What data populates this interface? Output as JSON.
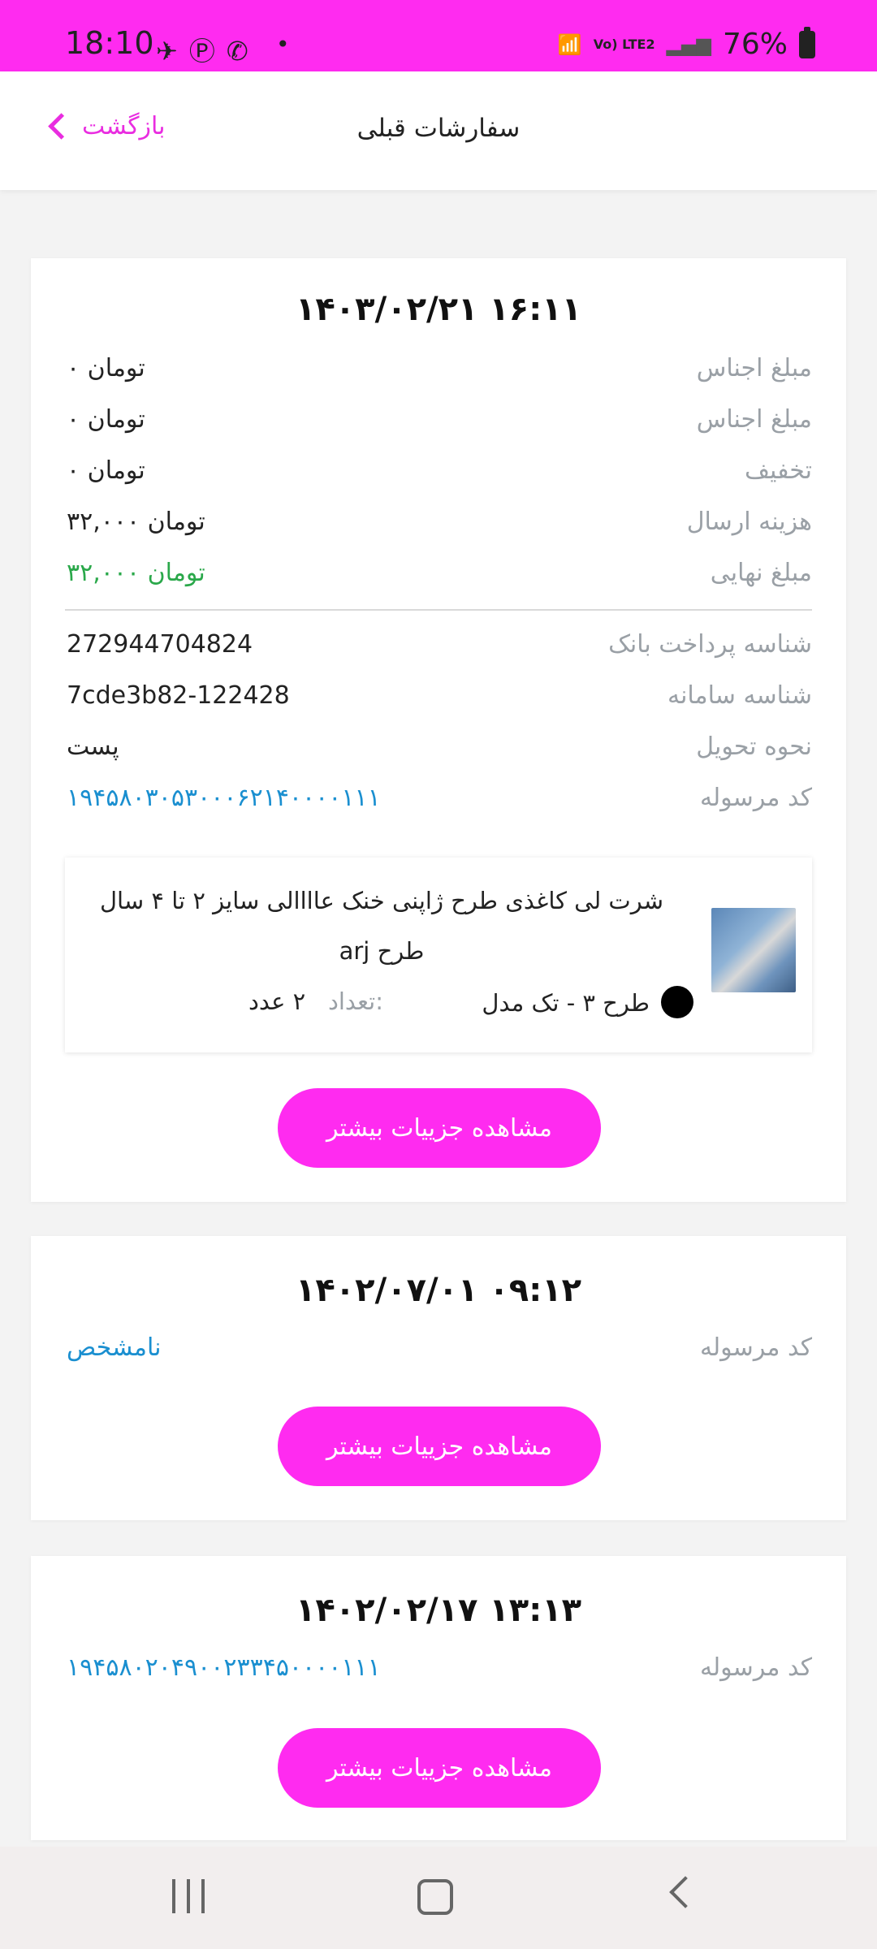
{
  "status_bar": {
    "time": "18:10",
    "battery": "76%",
    "network": "Vo) LTE2",
    "left_icons": [
      "navigation-icon",
      "pinterest-icon",
      "whatsapp-icon"
    ],
    "colors": {
      "bar": "#ff2bf0"
    }
  },
  "header": {
    "title": "سفارشات قبلی",
    "back_label": "بازگشت"
  },
  "orders": [
    {
      "date": "۱۴۰۳/۰۲/۲۱ ۱۶:۱۱",
      "rows": [
        {
          "label": "مبلغ اجناس",
          "value": "۰ تومان"
        },
        {
          "label": "مبلغ اجناس",
          "value": "۰ تومان"
        },
        {
          "label": "تخفیف",
          "value": "۰ تومان"
        },
        {
          "label": "هزینه ارسال",
          "value": "۳۲,۰۰۰ تومان"
        },
        {
          "label": "مبلغ نهایی",
          "value": "۳۲,۰۰۰ تومان"
        }
      ],
      "rows2": [
        {
          "label": "شناسه پرداخت بانک",
          "value": "272944704824"
        },
        {
          "label": "شناسه سامانه",
          "value": "7cde3b82-122428"
        },
        {
          "label": "نحوه تحویل",
          "value": "پست"
        },
        {
          "label": "کد مرسوله",
          "value": "۱۹۴۵۸۰۳۰۵۳۰۰۰۶۲۱۴۰۰۰۰۱۱۱"
        }
      ],
      "item": {
        "title": "شرت لی کاغذی طرح ژاپنی خنک عاااالی سایز ۲ تا ۴ سال طرح arj",
        "variant": "طرح ۳  - تک مدل",
        "qty_label": "تعداد:",
        "qty_value": "۲ عدد"
      },
      "button": "مشاهده جزییات بیشتر"
    },
    {
      "date": "۱۴۰۲/۰۷/۰۱ ۰۹:۱۲",
      "rows": [
        {
          "label": "کد مرسوله",
          "value": "نامشخص"
        }
      ],
      "button": "مشاهده جزییات بیشتر"
    },
    {
      "date": "۱۴۰۲/۰۲/۱۷ ۱۳:۱۳",
      "rows": [
        {
          "label": "کد مرسوله",
          "value": "۱۹۴۵۸۰۲۰۴۹۰۰۲۳۳۴۵۰۰۰۰۱۱۱"
        }
      ],
      "button": "مشاهده جزییات بیشتر"
    }
  ],
  "colors": {
    "accent": "#ff2bf0",
    "green": "#2aa84a",
    "blue": "#1a8fd0"
  }
}
